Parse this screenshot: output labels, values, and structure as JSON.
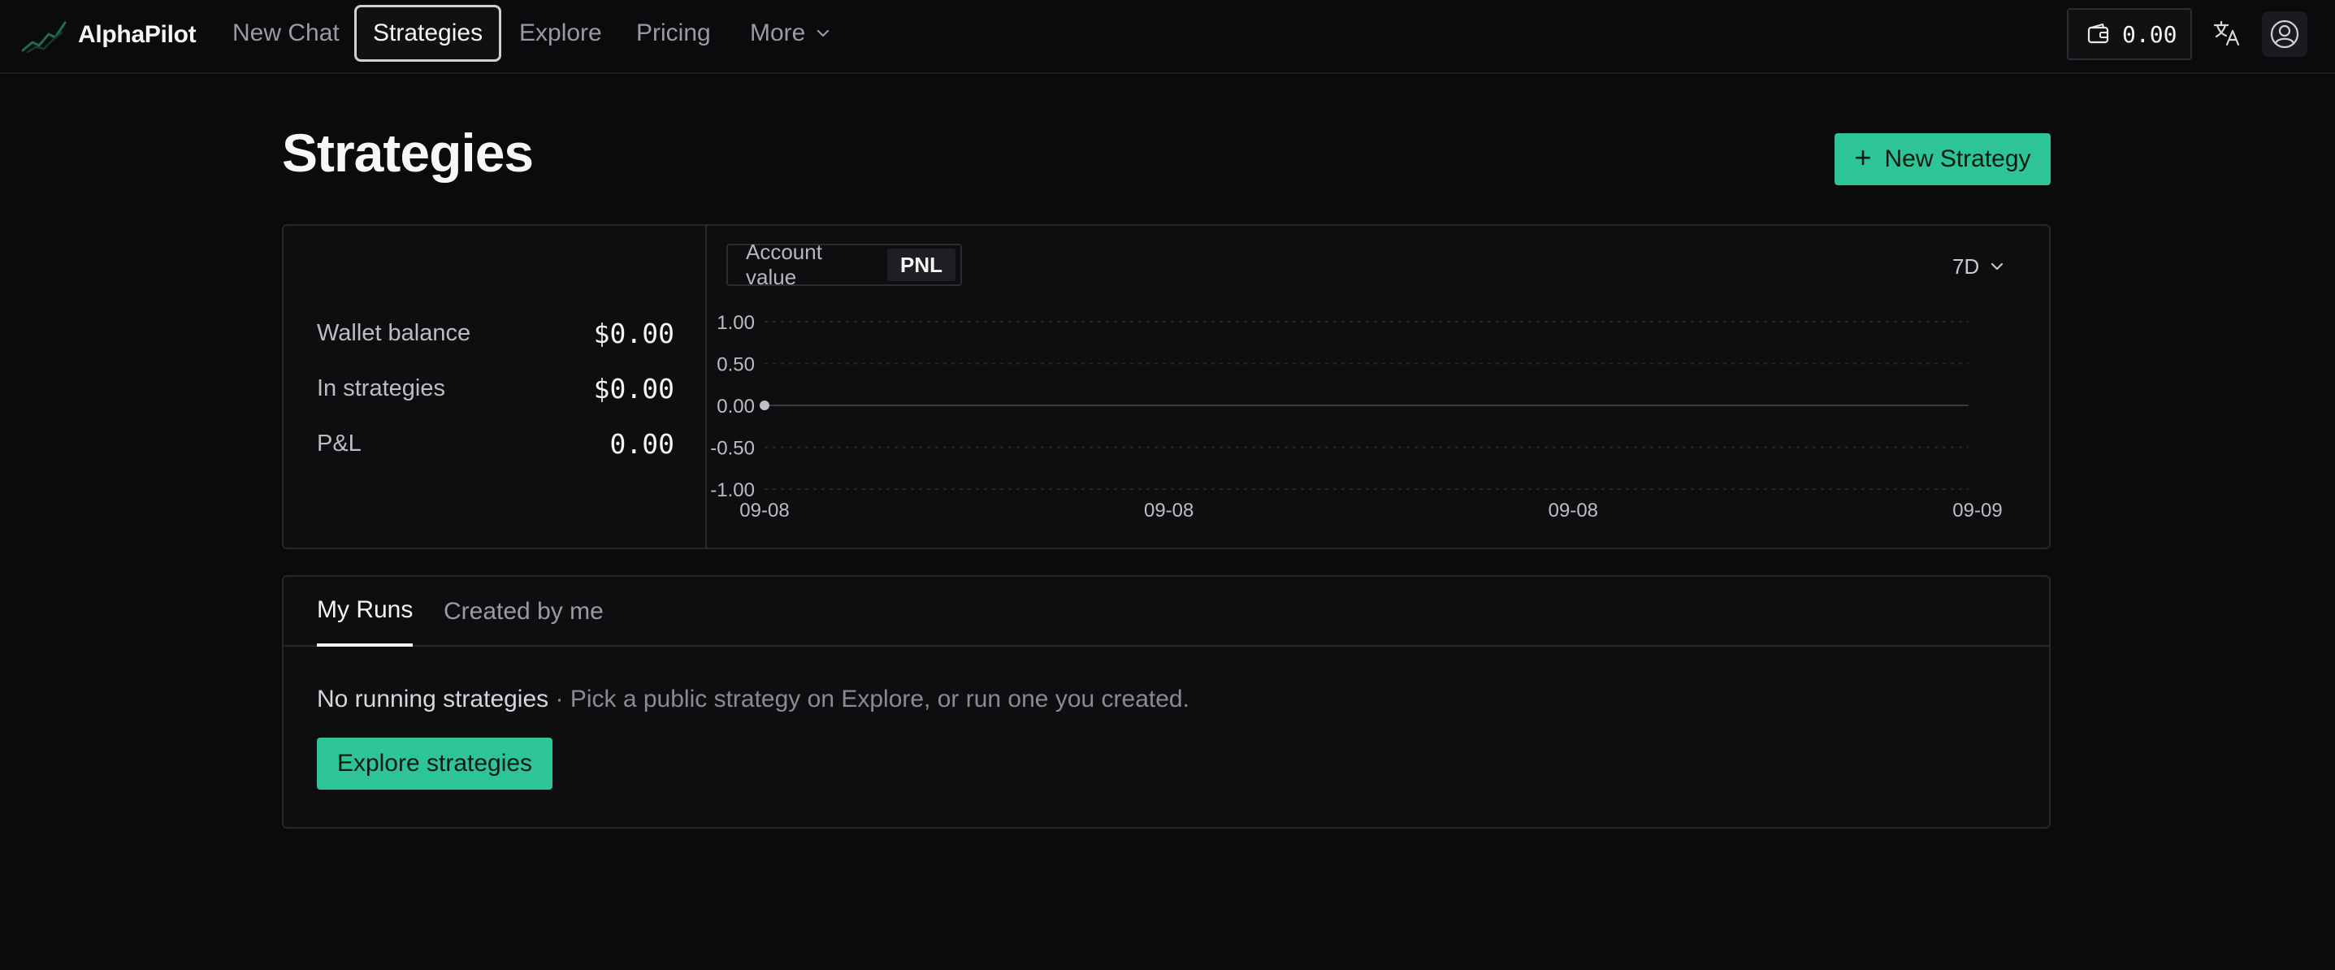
{
  "nav": {
    "brand": "AlphaPilot",
    "items": [
      {
        "label": "New Chat"
      },
      {
        "label": "Strategies"
      },
      {
        "label": "Explore"
      },
      {
        "label": "Pricing"
      },
      {
        "label": "More"
      }
    ],
    "active": "Strategies",
    "wallet_value": "0.00",
    "icons": [
      "chart-logo-icon",
      "chevron-down-icon",
      "wallet-icon",
      "translate-icon",
      "user-icon"
    ]
  },
  "page": {
    "title": "Strategies",
    "new_strategy_label": "New Strategy"
  },
  "summary": {
    "balances": [
      {
        "label": "Wallet balance",
        "value": "$0.00"
      },
      {
        "label": "In strategies",
        "value": "$0.00"
      },
      {
        "label": "P&L",
        "value": "0.00"
      }
    ],
    "toggle": [
      {
        "label": "Account value"
      },
      {
        "label": "PNL"
      }
    ],
    "toggle_selected": "PNL",
    "range": "7D"
  },
  "chart_data": {
    "type": "line",
    "x_tick_labels": [
      "09-08",
      "09-08",
      "09-08",
      "09-09"
    ],
    "y_tick_labels": [
      "1.00",
      "0.50",
      "0.00",
      "-0.50",
      "-1.00"
    ],
    "ylim": [
      -1,
      1
    ],
    "series": [
      {
        "points": [
          {
            "x": "09-08",
            "y": 0
          }
        ]
      }
    ],
    "grid": "dashed horizontal",
    "colors": {
      "line": "#3a3a40",
      "point": "#bfbfc5",
      "grid": "#26262b"
    }
  },
  "runs": {
    "tabs": [
      {
        "label": "My Runs"
      },
      {
        "label": "Created by me"
      }
    ],
    "active_tab": "My Runs",
    "empty_title": "No running strategies",
    "empty_hint": " · Pick a public strategy on Explore, or run one you created.",
    "explore_label": "Explore strategies"
  },
  "colors": {
    "accent": "#2ec596",
    "background": "#0b0b0d",
    "card": "#0e0e11",
    "border": "#26262b"
  }
}
